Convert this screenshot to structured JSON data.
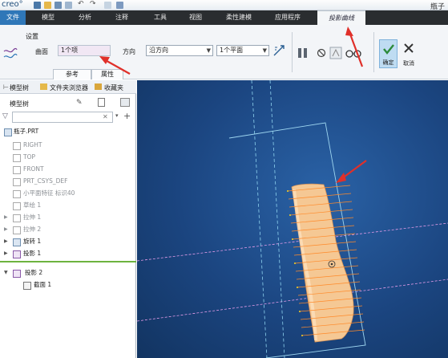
{
  "app": {
    "logo": "creo°",
    "window_title": "瓶子"
  },
  "ribbon_tabs": [
    "文件",
    "模型",
    "分析",
    "注释",
    "工具",
    "视图",
    "柔性建模",
    "应用程序",
    "投影曲线"
  ],
  "ribbon": {
    "group_settings": "设置",
    "surface_label": "曲面",
    "surface_value": "1个项",
    "direction_label": "方向",
    "direction_value": "沿方向",
    "plane_value": "1个平面",
    "subtabs": [
      "参考",
      "属性"
    ],
    "ok_label": "确定",
    "cancel_label": "取消"
  },
  "left_panel": {
    "tabs": [
      "模型树",
      "文件夹浏览器",
      "收藏夹"
    ],
    "tree_title": "模型树",
    "search_placeholder": "",
    "nodes": [
      {
        "label": "瓶子.PRT",
        "style": "root"
      },
      {
        "label": "RIGHT",
        "style": "gray"
      },
      {
        "label": "TOP",
        "style": "gray"
      },
      {
        "label": "FRONT",
        "style": "gray"
      },
      {
        "label": "PRT_CSYS_DEF",
        "style": "gray"
      },
      {
        "label": "小平面特征 标识40",
        "style": "gray"
      },
      {
        "label": "草绘 1",
        "style": "gray"
      },
      {
        "label": "拉伸 1",
        "style": "gray"
      },
      {
        "label": "拉伸 2",
        "style": "gray"
      },
      {
        "label": "旋转 1",
        "style": "normal"
      },
      {
        "label": "投影 1",
        "style": "normal"
      }
    ],
    "active_nodes": [
      {
        "label": "投影 2"
      },
      {
        "label": "截面 1"
      }
    ]
  },
  "colors": {
    "accent": "#2f77b8",
    "viewport": "#1b4580",
    "annotation": "#e0302a",
    "part": "#f3c58e"
  }
}
